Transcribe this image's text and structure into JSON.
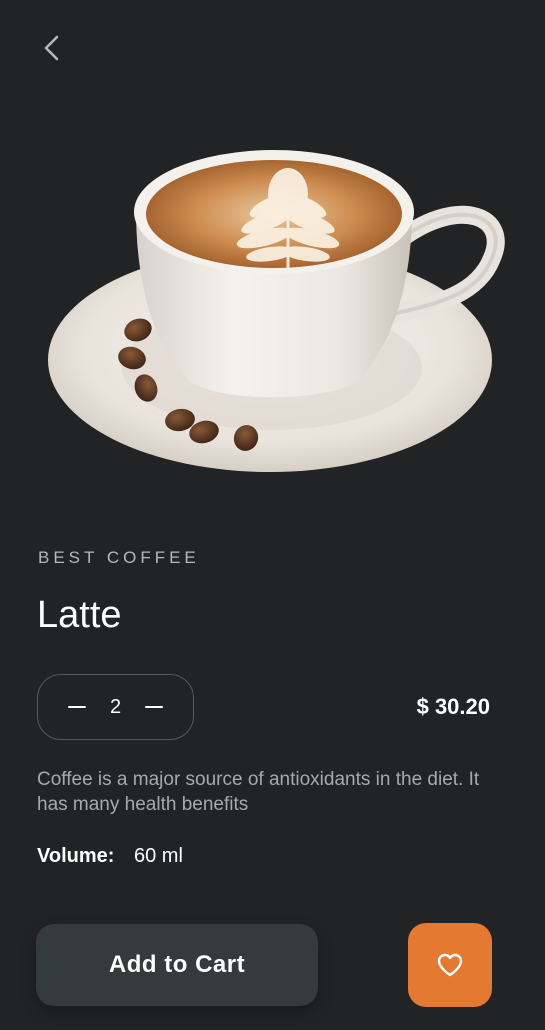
{
  "header": {
    "back_icon": "chevron-left-icon"
  },
  "product": {
    "image_alt": "Latte coffee cup on saucer with coffee beans",
    "category": "BEST COFFEE",
    "name": "Latte",
    "quantity": "2",
    "price": "$ 30.20",
    "description": "Coffee is a major source of antioxidants in the diet. It has many health benefits",
    "volume_label": "Volume:",
    "volume_value": "60 ml"
  },
  "actions": {
    "add_to_cart_label": "Add to Cart",
    "favorite_icon": "heart-icon"
  },
  "colors": {
    "background": "#222325",
    "accent": "#e47a32",
    "button_dark": "#353a3a"
  }
}
